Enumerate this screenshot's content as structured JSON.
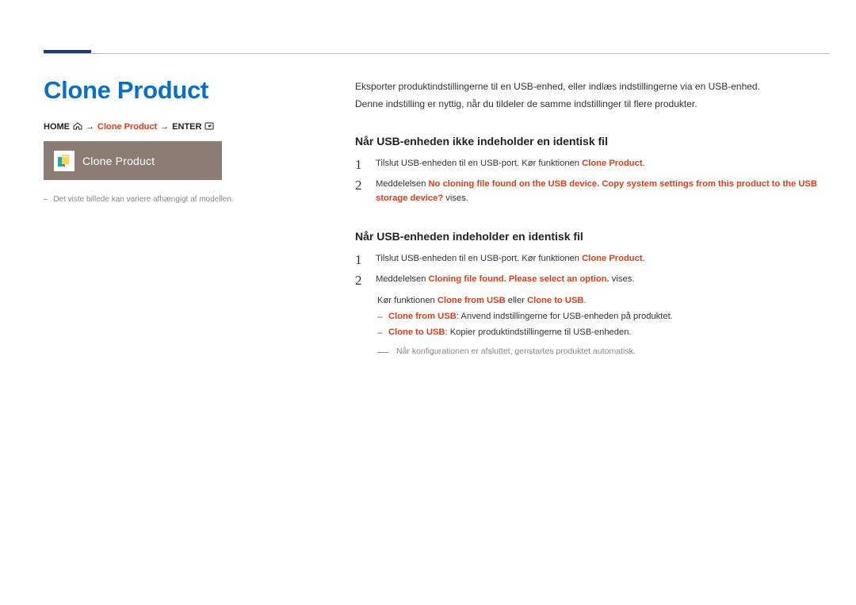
{
  "title": "Clone Product",
  "breadcrumb": {
    "home": "HOME",
    "item": "Clone Product",
    "enter": "ENTER",
    "arrow": "→"
  },
  "preview": {
    "label": "Clone Product"
  },
  "footnote": "Det viste billede kan variere afhængigt af modellen.",
  "intro": {
    "line1": "Eksporter produktindstillingerne til en USB-enhed, eller indlæs indstillingerne via en USB-enhed.",
    "line2": "Denne indstilling er nyttig, når du tildeler de samme indstillinger til flere produkter."
  },
  "section1": {
    "heading": "Når USB-enheden ikke indeholder en identisk fil",
    "step1_a": "Tilslut USB-enheden til en USB-port. Kør funktionen ",
    "step1_b": "Clone Product",
    "step1_c": ".",
    "step2_a": "Meddelelsen ",
    "step2_b": "No cloning file found on the USB device. Copy system settings from this product to the USB storage device?",
    "step2_c": " vises."
  },
  "section2": {
    "heading": "Når USB-enheden indeholder en identisk fil",
    "step1_a": "Tilslut USB-enheden til en USB-port. Kør funktionen ",
    "step1_b": "Clone Product",
    "step1_c": ".",
    "step2_a": "Meddelelsen ",
    "step2_b": "Cloning file found. Please select an option.",
    "step2_c": " vises.",
    "run_a": "Kør funktionen ",
    "run_b": "Clone from USB",
    "run_c": " eller ",
    "run_d": "Clone to USB",
    "run_e": ".",
    "opt1_label": "Clone from USB",
    "opt1_text": ": Anvend indstillingerne for USB-enheden på produktet.",
    "opt2_label": "Clone to USB",
    "opt2_text": ": Kopier produktindstillingerne til USB-enheden.",
    "note": "Når konfigurationen er afsluttet, genstartes produktet automatisk."
  },
  "nums": {
    "one": "1",
    "two": "2"
  }
}
